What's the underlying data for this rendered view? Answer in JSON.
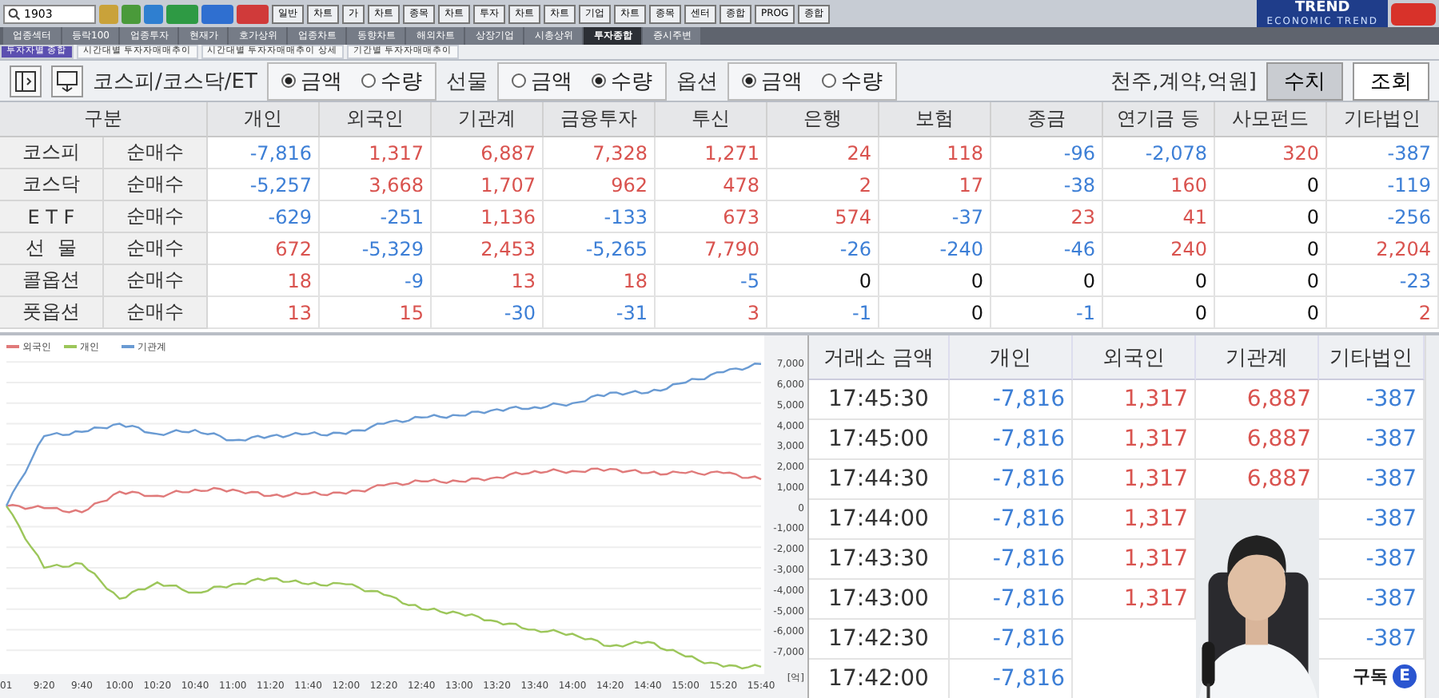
{
  "toolbar": {
    "search": "1903",
    "buttons": [
      "일반",
      "차트",
      "가",
      "차트",
      "종목",
      "차트",
      "투자",
      "차트",
      "차트",
      "기업",
      "차트",
      "종목",
      "센터",
      "종합",
      "PROG",
      "종합"
    ]
  },
  "logo": {
    "title": "TREND",
    "subtitle": "ECONOMIC TREND"
  },
  "tabs": [
    {
      "label": "업종섹터",
      "selected": false
    },
    {
      "label": "등락100",
      "selected": false
    },
    {
      "label": "업종투자",
      "selected": false
    },
    {
      "label": "현재가",
      "selected": false
    },
    {
      "label": "호가상위",
      "selected": false
    },
    {
      "label": "업종차트",
      "selected": false
    },
    {
      "label": "동향차트",
      "selected": false
    },
    {
      "label": "해외차트",
      "selected": false
    },
    {
      "label": "상장기업",
      "selected": false
    },
    {
      "label": "시총상위",
      "selected": false
    },
    {
      "label": "투자종합",
      "selected": true
    },
    {
      "label": "증시주변",
      "selected": false
    }
  ],
  "subtabs": [
    {
      "label": "투자자별 종합",
      "selected": true
    },
    {
      "label": "시간대별 투자자매매추이",
      "selected": false
    },
    {
      "label": "시간대별 투자자매매추이 상세",
      "selected": false
    },
    {
      "label": "기간별 투자자매매추이",
      "selected": false
    }
  ],
  "filters": [
    {
      "label": "코스피/코스닥/ET",
      "options": [
        {
          "label": "금액",
          "selected": true
        },
        {
          "label": "수량",
          "selected": false
        }
      ]
    },
    {
      "label": "선물",
      "options": [
        {
          "label": "금액",
          "selected": false
        },
        {
          "label": "수량",
          "selected": true
        }
      ]
    },
    {
      "label": "옵션",
      "options": [
        {
          "label": "금액",
          "selected": true
        },
        {
          "label": "수량",
          "selected": false
        }
      ]
    }
  ],
  "unit": "천주,계약,억원]",
  "actions": [
    {
      "label": "수치",
      "pressed": true
    },
    {
      "label": "조회",
      "pressed": false
    }
  ],
  "summary_table": {
    "columns": [
      "구분",
      "개인",
      "외국인",
      "기관계",
      "금융투자",
      "투신",
      "은행",
      "보험",
      "종금",
      "연기금 등",
      "사모펀드",
      "기타법인"
    ],
    "rows": [
      {
        "market": "코스피",
        "type": "순매수",
        "values": [
          "-7,816",
          "1,317",
          "6,887",
          "7,328",
          "1,271",
          "24",
          "118",
          "-96",
          "-2,078",
          "320",
          "-387"
        ]
      },
      {
        "market": "코스닥",
        "type": "순매수",
        "values": [
          "-5,257",
          "3,668",
          "1,707",
          "962",
          "478",
          "2",
          "17",
          "-38",
          "160",
          "0",
          "-119"
        ]
      },
      {
        "market": "E T F",
        "type": "순매수",
        "values": [
          "-629",
          "-251",
          "1,136",
          "-133",
          "673",
          "574",
          "-37",
          "23",
          "41",
          "0",
          "-256"
        ]
      },
      {
        "market": "선  물",
        "type": "순매수",
        "values": [
          "672",
          "-5,329",
          "2,453",
          "-5,265",
          "7,790",
          "-26",
          "-240",
          "-46",
          "240",
          "0",
          "2,204"
        ]
      },
      {
        "market": "콜옵션",
        "type": "순매수",
        "values": [
          "18",
          "-9",
          "13",
          "18",
          "-5",
          "0",
          "0",
          "0",
          "0",
          "0",
          "-23"
        ]
      },
      {
        "market": "풋옵션",
        "type": "순매수",
        "values": [
          "13",
          "15",
          "-30",
          "-31",
          "3",
          "-1",
          "0",
          "-1",
          "0",
          "0",
          "2"
        ]
      }
    ]
  },
  "chart": {
    "chart_data": {
      "type": "line",
      "grid": true,
      "legend": true,
      "x": [
        "01",
        "9:20",
        "9:40",
        "10:00",
        "10:20",
        "10:40",
        "11:00",
        "11:20",
        "11:40",
        "12:00",
        "12:20",
        "12:40",
        "13:00",
        "13:20",
        "13:40",
        "14:00",
        "14:20",
        "14:40",
        "15:00",
        "15:20",
        "15:40"
      ],
      "ylabel": "[억]",
      "ylim": [
        -8000,
        7200
      ],
      "yticks": [
        {
          "value": 7000,
          "label": "7,000"
        },
        {
          "value": 6000,
          "label": "6,000"
        },
        {
          "value": 5000,
          "label": "5,000"
        },
        {
          "value": 4000,
          "label": "4,000"
        },
        {
          "value": 3000,
          "label": "3,000"
        },
        {
          "value": 2000,
          "label": "2,000"
        },
        {
          "value": 1000,
          "label": "1,000"
        },
        {
          "value": 0,
          "label": "0"
        },
        {
          "value": -1000,
          "label": "-1,000"
        },
        {
          "value": -2000,
          "label": "-2,000"
        },
        {
          "value": -3000,
          "label": "-3,000"
        },
        {
          "value": -4000,
          "label": "-4,000"
        },
        {
          "value": -5000,
          "label": "-5,000"
        },
        {
          "value": -6000,
          "label": "-6,000"
        },
        {
          "value": -7000,
          "label": "-7,000"
        }
      ],
      "series": [
        {
          "name": "외국인",
          "color": "#e07a7a",
          "values": [
            0,
            -100,
            -300,
            700,
            500,
            800,
            800,
            500,
            600,
            600,
            1000,
            1200,
            1200,
            1400,
            1700,
            1700,
            1800,
            1600,
            1600,
            1600,
            1300
          ]
        },
        {
          "name": "개인",
          "color": "#9cc65a",
          "values": [
            0,
            -3000,
            -2800,
            -4500,
            -3700,
            -4200,
            -3800,
            -3500,
            -3800,
            -3800,
            -4300,
            -5000,
            -5200,
            -5600,
            -6000,
            -6200,
            -6800,
            -6600,
            -7300,
            -7800,
            -7800
          ]
        },
        {
          "name": "기관계",
          "color": "#6a9bd3",
          "values": [
            0,
            3400,
            3600,
            4000,
            3500,
            3700,
            3200,
            3400,
            3500,
            3500,
            4000,
            4300,
            4400,
            4700,
            4800,
            5000,
            5500,
            5500,
            6000,
            6500,
            6900
          ]
        }
      ]
    }
  },
  "time_table": {
    "columns": [
      "거래소 금액",
      "개인",
      "외국인",
      "기관계",
      "기타법인"
    ],
    "rows": [
      {
        "cells": [
          "17:45:30",
          "-7,816",
          "1,317",
          "6,887",
          "-387"
        ]
      },
      {
        "cells": [
          "17:45:00",
          "-7,816",
          "1,317",
          "6,887",
          "-387"
        ]
      },
      {
        "cells": [
          "17:44:30",
          "-7,816",
          "1,317",
          "6,887",
          "-387"
        ]
      },
      {
        "cells": [
          "17:44:00",
          "-7,816",
          "1,317",
          null,
          "-387"
        ]
      },
      {
        "cells": [
          "17:43:30",
          "-7,816",
          "1,317",
          null,
          "-387"
        ]
      },
      {
        "cells": [
          "17:43:00",
          "-7,816",
          "1,317",
          null,
          "-387"
        ]
      },
      {
        "cells": [
          "17:42:30",
          "-7,816",
          null,
          null,
          "-387"
        ]
      },
      {
        "cells": [
          "17:42:00",
          "-7,816",
          null,
          null,
          null
        ]
      }
    ]
  },
  "video": {
    "kind": "picture",
    "badge": "구독",
    "badge_logo": "E"
  }
}
